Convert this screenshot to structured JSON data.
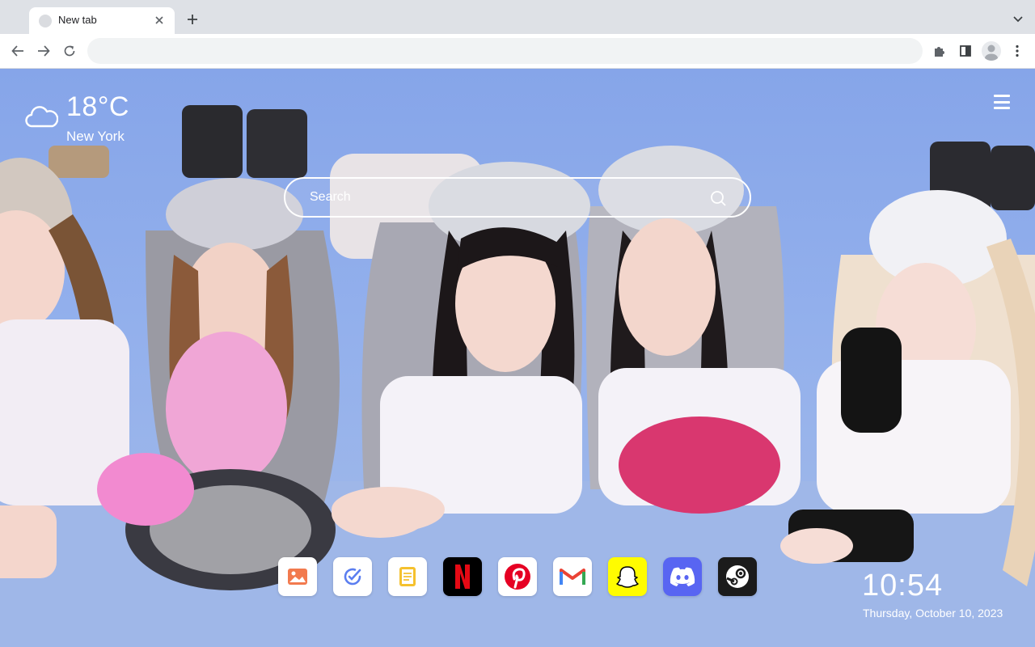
{
  "tab": {
    "title": "New tab",
    "close_icon": "close-icon"
  },
  "toolbar": {
    "omnibox_value": "",
    "icons": [
      "back-arrow-icon",
      "forward-arrow-icon",
      "reload-icon",
      "extensions-puzzle-icon",
      "side-panel-icon",
      "profile-avatar-icon",
      "kebab-menu-icon"
    ]
  },
  "weather": {
    "temperature": "18°C",
    "city": "New York",
    "icon": "cloud-icon"
  },
  "search": {
    "placeholder": "Search"
  },
  "dock": {
    "apps": [
      {
        "name": "photos",
        "icon": "image-icon"
      },
      {
        "name": "tasks",
        "icon": "checkmark-circle-icon"
      },
      {
        "name": "notes",
        "icon": "notepad-icon"
      },
      {
        "name": "netflix",
        "icon": "netflix-icon",
        "label": "N"
      },
      {
        "name": "pinterest",
        "icon": "pinterest-icon",
        "label": "P"
      },
      {
        "name": "gmail",
        "icon": "gmail-icon",
        "label": "M"
      },
      {
        "name": "snapchat",
        "icon": "snapchat-ghost-icon"
      },
      {
        "name": "discord",
        "icon": "discord-icon"
      },
      {
        "name": "steam",
        "icon": "steam-icon"
      }
    ]
  },
  "clock": {
    "time": "10:54",
    "date": "Thursday, October 10, 2023"
  },
  "colors": {
    "tabstrip": "#dee1e6",
    "netflix_red": "#e50914",
    "pinterest_red": "#e60023",
    "snapchat_yellow": "#fffc00",
    "discord_blurple": "#5865f2",
    "steam_dark": "#1b1b1b"
  }
}
